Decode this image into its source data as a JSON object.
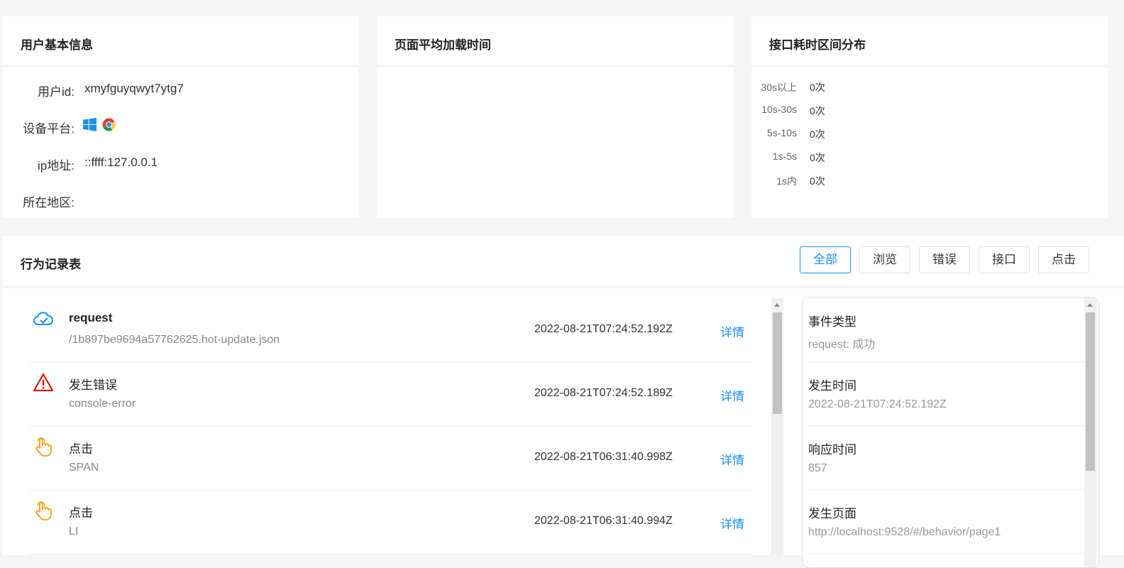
{
  "user_card": {
    "title": "用户基本信息",
    "rows": [
      {
        "label": "用户id:",
        "value": "xmyfguyqwyt7ytg7"
      },
      {
        "label": "设备平台:",
        "value": ""
      },
      {
        "label": "ip地址:",
        "value": "::ffff:127.0.0.1"
      },
      {
        "label": "所在地区:",
        "value": ""
      }
    ],
    "platform_icons": [
      "windows-icon",
      "chrome-icon"
    ]
  },
  "load_card": {
    "title": "页面平均加载时间"
  },
  "interval_card": {
    "title": "接口耗时区间分布",
    "rows": [
      {
        "label": "30s以上",
        "value": "0次"
      },
      {
        "label": "10s-30s",
        "value": "0次"
      },
      {
        "label": "5s-10s",
        "value": "0次"
      },
      {
        "label": "1s-5s",
        "value": "0次"
      },
      {
        "label": "1s内",
        "value": "0次"
      }
    ]
  },
  "behavior": {
    "title": "行为记录表",
    "filters": [
      "全部",
      "浏览",
      "错误",
      "接口",
      "点击"
    ],
    "active_filter": "全部",
    "items": [
      {
        "icon": "cloud-check-icon",
        "title": "request",
        "sub": "/1b897be9694a57762625.hot-update.json",
        "time": "2022-08-21T07:24:52.192Z",
        "action": "详情"
      },
      {
        "icon": "warning-icon",
        "title": "发生错误",
        "sub": "console-error",
        "time": "2022-08-21T07:24:52.189Z",
        "action": "详情"
      },
      {
        "icon": "hand-pointer-icon",
        "title": "点击",
        "sub": "SPAN",
        "time": "2022-08-21T06:31:40.998Z",
        "action": "详情"
      },
      {
        "icon": "hand-pointer-icon",
        "title": "点击",
        "sub": "LI",
        "time": "2022-08-21T06:31:40.994Z",
        "action": "详情"
      }
    ],
    "detail": [
      {
        "label": "事件类型",
        "value": "request: 成功"
      },
      {
        "label": "发生时间",
        "value": "2022-08-21T07:24:52.192Z"
      },
      {
        "label": "响应时间",
        "value": "857"
      },
      {
        "label": "发生页面",
        "value": "http://localhost:9528/#/behavior/page1"
      }
    ]
  },
  "colors": {
    "accent": "#1890ff",
    "error": "#d81e06",
    "click": "#f5a623",
    "request": "#1890ff"
  }
}
